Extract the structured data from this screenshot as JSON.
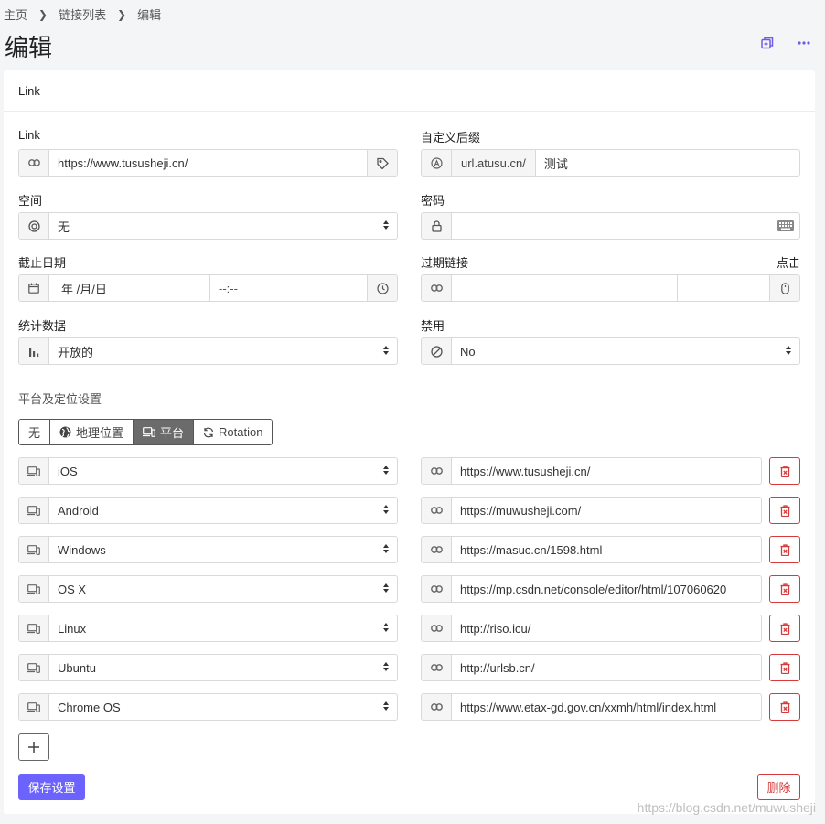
{
  "breadcrumb": [
    "主页",
    "链接列表",
    "编辑"
  ],
  "page_title": "编辑",
  "card_title": "Link",
  "fields": {
    "link_label": "Link",
    "link_value": "https://www.tususheji.cn/",
    "suffix_label": "自定义后缀",
    "suffix_domain": "url.atusu.cn/",
    "suffix_value": "测试",
    "space_label": "空间",
    "space_value": "无",
    "password_label": "密码",
    "password_value": "",
    "expiry_label": "截止日期",
    "expiry_date": "年 /月/日",
    "expiry_time": "--:--",
    "expired_link_label": "过期链接",
    "clicks_label": "点击",
    "stats_label": "统计数据",
    "stats_value": "开放的",
    "disabled_label": "禁用",
    "disabled_value": "No"
  },
  "targeting": {
    "label": "平台及定位设置",
    "options": [
      "无",
      "地理位置",
      "平台",
      "Rotation"
    ],
    "active": "平台",
    "rows": [
      {
        "platform": "iOS",
        "url": "https://www.tususheji.cn/"
      },
      {
        "platform": "Android",
        "url": "https://muwusheji.com/"
      },
      {
        "platform": "Windows",
        "url": "https://masuc.cn/1598.html"
      },
      {
        "platform": "OS X",
        "url": "https://mp.csdn.net/console/editor/html/107060620"
      },
      {
        "platform": "Linux",
        "url": "http://riso.icu/"
      },
      {
        "platform": "Ubuntu",
        "url": "http://urlsb.cn/"
      },
      {
        "platform": "Chrome OS",
        "url": "https://www.etax-gd.gov.cn/xxmh/html/index.html"
      }
    ]
  },
  "buttons": {
    "save": "保存设置",
    "delete": "删除"
  },
  "watermark": "https://blog.csdn.net/muwusheji",
  "colors": {
    "accent": "#6c63ff",
    "danger": "#d63a3a"
  }
}
